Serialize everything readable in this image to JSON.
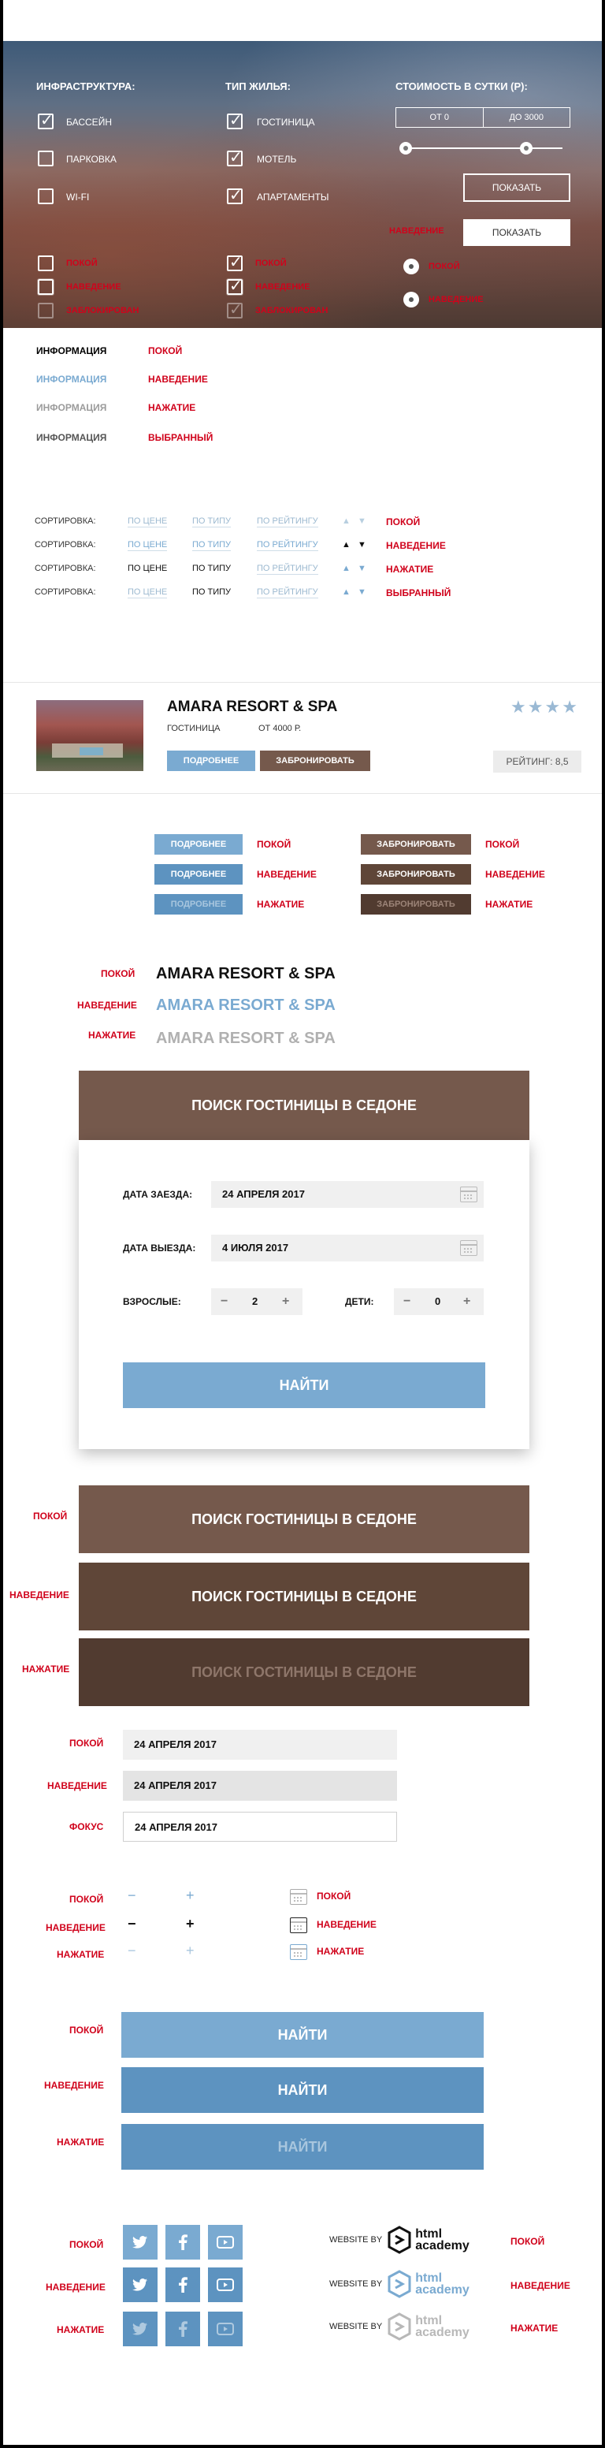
{
  "hero": {
    "infrastructure": {
      "title": "ИНФРАСТРУКТУРА:",
      "items": [
        "БАССЕЙН",
        "ПАРКОВКА",
        "WI-FI"
      ]
    },
    "housing": {
      "title": "ТИП ЖИЛЬЯ:",
      "items": [
        "ГОСТИНИЦА",
        "МОТЕЛЬ",
        "АПАРТАМЕНТЫ"
      ]
    },
    "price": {
      "title": "СТОИМОСТЬ В СУТКИ (Р):",
      "from": "ОТ 0",
      "to": "ДО 3000"
    },
    "show_button": "ПОКАЗАТЬ",
    "show_button_hover_label": "НАВЕДЕНИЕ",
    "checkbox_states": [
      "ПОКОЙ",
      "НАВЕДЕНИЕ",
      "ЗАБЛОКИРОВАН"
    ],
    "checked_states": [
      "ПОКОЙ",
      "НАВЕДЕНИЕ",
      "ЗАБЛОКИРОВАН"
    ],
    "radio_states": [
      "ПОКОЙ",
      "НАВЕДЕНИЕ"
    ]
  },
  "info": {
    "label": "ИНФОРМАЦИЯ",
    "states": [
      "ПОКОЙ",
      "НАВЕДЕНИЕ",
      "НАЖАТИЕ",
      "ВЫБРАННЫЙ"
    ],
    "colors": [
      "#111111",
      "#7aaad1",
      "#9b9b9b",
      "#555555"
    ]
  },
  "sort": {
    "label": "СОРТИРОВКА:",
    "options": [
      "ПО ЦЕНЕ",
      "ПО ТИПУ",
      "ПО РЕЙТИНГУ"
    ],
    "states": [
      "ПОКОЙ",
      "НАВЕДЕНИЕ",
      "НАЖАТИЕ",
      "ВЫБРАННЫЙ"
    ],
    "arrow_up": "▲",
    "arrow_down": "▼"
  },
  "card": {
    "name": "AMARA RESORT & SPA",
    "type": "ГОСТИНИЦА",
    "price": "ОТ 4000 Р.",
    "stars": 4,
    "star_glyph": "★",
    "more": "ПОДРОБНЕЕ",
    "book": "ЗАБРОНИРОВАТЬ",
    "rating": "РЕЙТИНГ: 8,5"
  },
  "button_states": [
    "ПОКОЙ",
    "НАВЕДЕНИЕ",
    "НАЖАТИЕ"
  ],
  "hotel_link": {
    "text": "AMARA RESORT & SPA",
    "states": [
      "ПОКОЙ",
      "НАВЕДЕНИЕ",
      "НАЖАТИЕ"
    ],
    "colors": [
      "#111111",
      "#7aaad1",
      "#b0b0b0"
    ]
  },
  "search": {
    "title": "ПОИСК ГОСТИНИЦЫ В СЕДОНЕ",
    "checkin_label": "ДАТА ЗАЕЗДА:",
    "checkin_value": "24 АПРЕЛЯ 2017",
    "checkout_label": "ДАТА ВЫЕЗДА:",
    "checkout_value": "4 ИЮЛЯ 2017",
    "adults_label": "ВЗРОСЛЫЕ:",
    "adults_value": "2",
    "children_label": "ДЕТИ:",
    "children_value": "0",
    "minus": "−",
    "plus": "+",
    "find": "НАЙТИ"
  },
  "header_states": [
    "ПОКОЙ",
    "НАВЕДЕНИЕ",
    "НАЖАТИЕ"
  ],
  "date_field_states": [
    "ПОКОЙ",
    "НАВЕДЕНИЕ",
    "ФОКУС"
  ],
  "date_value": "24 АПРЕЛЯ 2017",
  "stepper_states": [
    "ПОКОЙ",
    "НАВЕДЕНИЕ",
    "НАЖАТИЕ"
  ],
  "calendar_states": [
    "ПОКОЙ",
    "НАВЕДЕНИЕ",
    "НАЖАТИЕ"
  ],
  "find_states": [
    "ПОКОЙ",
    "НАВЕДЕНИЕ",
    "НАЖАТИЕ"
  ],
  "social_states": [
    "ПОКОЙ",
    "НАВЕДЕНИЕ",
    "НАЖАТИЕ"
  ],
  "social_icons": [
    "twitter-icon",
    "facebook-icon",
    "youtube-icon"
  ],
  "footer": {
    "website_by": "WEBSITE BY",
    "brand_line1": "html",
    "brand_line2": "academy",
    "states": [
      "ПОКОЙ",
      "НАВЕДЕНИЕ",
      "НАЖАТИЕ"
    ]
  },
  "colors": {
    "blue": "#7aaad1",
    "brown": "#75594c",
    "red": "#d0021b"
  }
}
